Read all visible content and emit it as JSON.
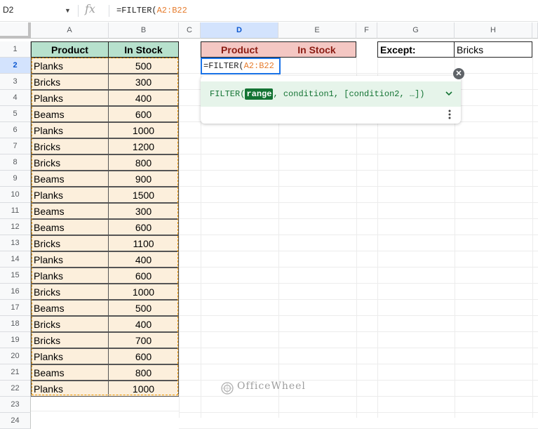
{
  "formula_bar": {
    "cell_ref": "D2",
    "fx_symbol": "fx",
    "formula_prefix": "=FILTER(",
    "formula_range": "A2:B22"
  },
  "columns": [
    "A",
    "B",
    "C",
    "D",
    "E",
    "F",
    "G",
    "H"
  ],
  "selected_column": "D",
  "rows": [
    "1",
    "2",
    "3",
    "4",
    "5",
    "6",
    "7",
    "8",
    "9",
    "10",
    "11",
    "12",
    "13",
    "14",
    "15",
    "16",
    "17",
    "18",
    "19",
    "20",
    "21",
    "22",
    "23",
    "24"
  ],
  "selected_row": "2",
  "headers": {
    "a1": "Product",
    "b1": "In Stock",
    "d1": "Product",
    "e1": "In Stock",
    "g1": "Except:",
    "h1": "Bricks"
  },
  "data_rows": [
    {
      "product": "Planks",
      "stock": "500"
    },
    {
      "product": "Bricks",
      "stock": "300"
    },
    {
      "product": "Planks",
      "stock": "400"
    },
    {
      "product": "Beams",
      "stock": "600"
    },
    {
      "product": "Planks",
      "stock": "1000"
    },
    {
      "product": "Bricks",
      "stock": "1200"
    },
    {
      "product": "Bricks",
      "stock": "800"
    },
    {
      "product": "Beams",
      "stock": "900"
    },
    {
      "product": "Planks",
      "stock": "1500"
    },
    {
      "product": "Beams",
      "stock": "300"
    },
    {
      "product": "Beams",
      "stock": "600"
    },
    {
      "product": "Bricks",
      "stock": "1100"
    },
    {
      "product": "Planks",
      "stock": "400"
    },
    {
      "product": "Planks",
      "stock": "600"
    },
    {
      "product": "Bricks",
      "stock": "1000"
    },
    {
      "product": "Beams",
      "stock": "500"
    },
    {
      "product": "Bricks",
      "stock": "400"
    },
    {
      "product": "Bricks",
      "stock": "700"
    },
    {
      "product": "Planks",
      "stock": "600"
    },
    {
      "product": "Beams",
      "stock": "800"
    },
    {
      "product": "Planks",
      "stock": "1000"
    }
  ],
  "editor": {
    "prefix": "=FILTER(",
    "range": "A2:B22"
  },
  "tooltip": {
    "func": "FILTER(",
    "active_arg": "range",
    "rest": ", condition1, [condition2, …])",
    "chevron_icon": "chevron-down-icon",
    "more_icon": "more-vert-icon",
    "close_icon": "close-icon"
  },
  "watermark": "OfficeWheel",
  "colors": {
    "green_header": "#b7e1cd",
    "red_header": "#f4c7c3",
    "data_fill": "#fcefdc",
    "range_dash": "#f29900",
    "selection_blue": "#1a73e8"
  }
}
